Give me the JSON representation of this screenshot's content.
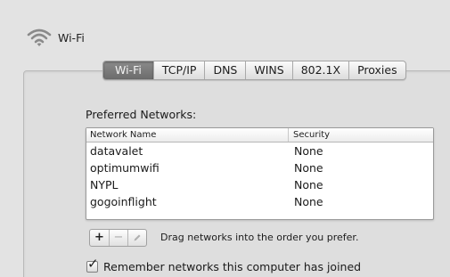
{
  "header": {
    "title": "Wi-Fi",
    "icon": "wifi-icon"
  },
  "tabs": [
    {
      "label": "Wi-Fi",
      "active": true
    },
    {
      "label": "TCP/IP",
      "active": false
    },
    {
      "label": "DNS",
      "active": false
    },
    {
      "label": "WINS",
      "active": false
    },
    {
      "label": "802.1X",
      "active": false
    },
    {
      "label": "Proxies",
      "active": false
    }
  ],
  "preferred": {
    "label": "Preferred Networks:",
    "columns": {
      "name": "Network Name",
      "security": "Security"
    },
    "rows": [
      {
        "name": "datavalet",
        "security": "None"
      },
      {
        "name": "optimumwifi",
        "security": "None"
      },
      {
        "name": "NYPL",
        "security": "None"
      },
      {
        "name": "gogoinflight",
        "security": "None"
      }
    ]
  },
  "controls": {
    "add": "+",
    "remove": "−",
    "hint": "Drag networks into the order you prefer."
  },
  "remember": {
    "label": "Remember networks this computer has joined",
    "checked": true
  }
}
